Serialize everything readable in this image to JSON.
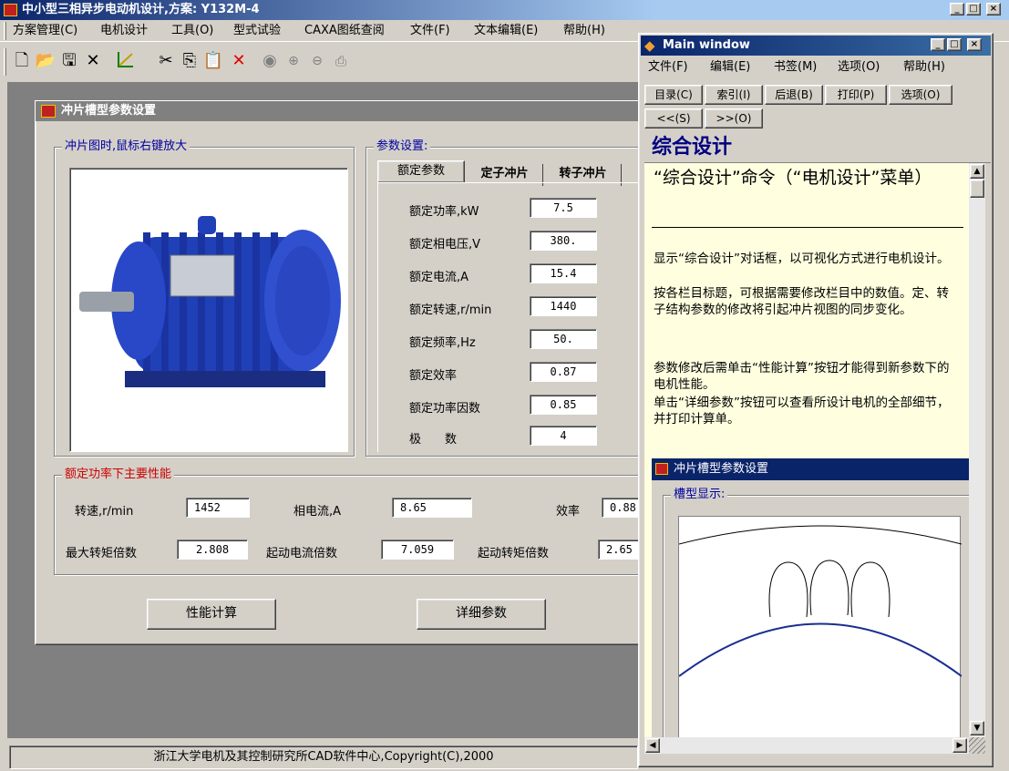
{
  "app": {
    "title": "中小型三相异步电动机设计,方案: Y132M-4",
    "menu": [
      "方案管理(C)",
      "电机设计",
      "工具(O)",
      "型式试验",
      "CAXA图纸查阅",
      "文件(F)",
      "文本编辑(E)",
      "帮助(H)"
    ],
    "toolbar_icons": [
      "new-file-icon",
      "open-folder-icon",
      "save-icon",
      "close-x-icon",
      "line-chart-icon",
      "cut-icon",
      "copy-icon",
      "paste-icon",
      "delete-x-icon",
      "record-icon",
      "zoom-in-icon",
      "zoom-out-icon",
      "print-icon"
    ],
    "status": "浙江大学电机及其控制研究所CAD软件中心,Copyright(C),2000",
    "window_buttons": [
      "_",
      "□",
      "×"
    ]
  },
  "dialog": {
    "title": "冲片槽型参数设置",
    "image_group_label": "冲片图时,鼠标右键放大",
    "params_group_label": "参数设置:",
    "tabs": [
      "额定参数",
      "定子冲片",
      "转子冲片"
    ],
    "params": [
      {
        "label": "额定功率,kW",
        "value": "7.5"
      },
      {
        "label": "额定相电压,V",
        "value": "380."
      },
      {
        "label": "额定电流,A",
        "value": "15.4"
      },
      {
        "label": "额定转速,r/min",
        "value": "1440"
      },
      {
        "label": "额定频率,Hz",
        "value": "50."
      },
      {
        "label": "额定效率",
        "value": "0.87"
      },
      {
        "label": "额定功率因数",
        "value": "0.85"
      },
      {
        "label": "极　　数",
        "value": "4"
      }
    ],
    "perf_group_label": "额定功率下主要性能",
    "perf": [
      {
        "label": "转速,r/min",
        "value": "1452"
      },
      {
        "label": "相电流,A",
        "value": "8.65"
      },
      {
        "label": "效率",
        "value": "0.88"
      },
      {
        "label": "最大转矩倍数",
        "value": "2.808"
      },
      {
        "label": "起动电流倍数",
        "value": "7.059"
      },
      {
        "label": "起动转矩倍数",
        "value": "2.65"
      }
    ],
    "buttons": [
      "性能计算",
      "详细参数"
    ]
  },
  "help": {
    "title": "Main window",
    "menu": [
      "文件(F)",
      "编辑(E)",
      "书签(M)",
      "选项(O)",
      "帮助(H)"
    ],
    "buttons_row1": [
      "目录(C)",
      "索引(I)",
      "后退(B)",
      "打印(P)",
      "选项(O)"
    ],
    "buttons_row2": [
      "<<(S)",
      ">>(O)"
    ],
    "heading": "综合设计",
    "subheading": "“综合设计”命令（“电机设计”菜单）",
    "paragraphs": [
      "显示“综合设计”对话框，以可视化方式进行电机设计。",
      "按各栏目标题，可根据需要修改栏目中的数值。定、转子结构参数的修改将引起冲片视图的同步变化。",
      "参数修改后需单击“性能计算”按钮才能得到新参数下的电机性能。",
      "单击“详细参数”按钮可以查看所设计电机的全部细节，并打印计算单。"
    ],
    "embedded_title": "冲片槽型参数设置",
    "embedded_group": "槽型显示:"
  },
  "colors": {
    "titlebar": "#0a246a",
    "help_bg": "#ffffe0",
    "heading": "#000080",
    "perf_label": "#cc0000",
    "motor": "#1f3fb0"
  }
}
